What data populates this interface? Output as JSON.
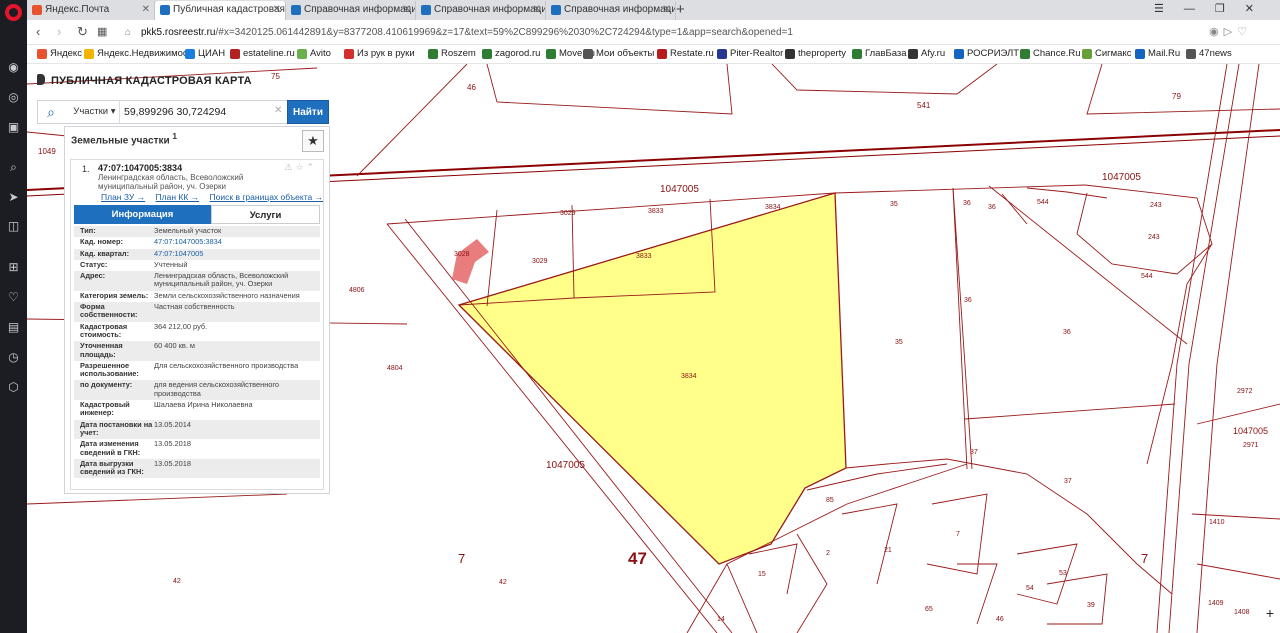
{
  "browser": {
    "tabs": [
      {
        "label": "Яндекс.Почта",
        "fav_color": "#e8532f"
      },
      {
        "label": "Публичная кадастровая к",
        "fav_color": "#1f6fbf"
      },
      {
        "label": "Справочная информация",
        "fav_color": "#1f6fbf"
      },
      {
        "label": "Справочная информация",
        "fav_color": "#1f6fbf"
      },
      {
        "label": "Справочная информация",
        "fav_color": "#1f6fbf"
      }
    ],
    "url_host": "pkk5.rosreestr.ru",
    "url_rest": "/#x=3420125.061442891&y=8377208.410619969&z=17&text=59%2C899296%2030%2C724294&type=1&app=search&opened=1",
    "bookmarks": [
      {
        "label": "Яндекс",
        "color": "#e8532f"
      },
      {
        "label": "Яндекс.Недвижимос",
        "color": "#f3b400"
      },
      {
        "label": "ЦИАН",
        "color": "#1a7ee0"
      },
      {
        "label": "estateline.ru",
        "color": "#b22222"
      },
      {
        "label": "Avito",
        "color": "#6ab04c"
      },
      {
        "label": "Из рук в руки",
        "color": "#d32f2f"
      },
      {
        "label": "Roszem",
        "color": "#2e7d32"
      },
      {
        "label": "zagorod.ru",
        "color": "#2e7d32"
      },
      {
        "label": "Move.su",
        "color": "#2e7d32"
      },
      {
        "label": "Мои объекты",
        "color": "#555555"
      },
      {
        "label": "Restate.ru",
        "color": "#b71c1c"
      },
      {
        "label": "Piter-Realtor",
        "color": "#283593"
      },
      {
        "label": "theproperty",
        "color": "#333333"
      },
      {
        "label": "ГлавБаза",
        "color": "#2e7d32"
      },
      {
        "label": "Afy.ru",
        "color": "#333333"
      },
      {
        "label": "РОСРИЭЛТ",
        "color": "#1565c0"
      },
      {
        "label": "Chance.Ru",
        "color": "#2e7d32"
      },
      {
        "label": "Сигмакс",
        "color": "#689f38"
      },
      {
        "label": "Mail.Ru",
        "color": "#1565c0"
      },
      {
        "label": "47news",
        "color": "#555555"
      }
    ]
  },
  "app": {
    "title": "ПУБЛИЧНАЯ КАДАСТРОВАЯ КАРТА",
    "search": {
      "type_label": "Участки",
      "value": "59,899296 30,724294",
      "button": "Найти"
    },
    "panel": {
      "heading": "Земельные участки",
      "heading_sup": "1",
      "result_num": "1.",
      "cad_number": "47:07:1047005:3834",
      "address_short": "Ленинградская область, Всеволожский муниципальный район, уч. Озерки",
      "links": [
        "План ЗУ →",
        "План КК →",
        "Поиск в границах объекта →"
      ],
      "tab_info": "Информация",
      "tab_services": "Услуги",
      "props": [
        {
          "k": "Тип:",
          "v": "Земельный участок"
        },
        {
          "k": "Кад. номер:",
          "v": "47:07:1047005:3834",
          "link": true
        },
        {
          "k": "Кад. квартал:",
          "v": "47:07:1047005",
          "link": true
        },
        {
          "k": "Статус:",
          "v": "Учтенный"
        },
        {
          "k": "Адрес:",
          "v": "Ленинградская область, Всеволожский муниципальный район, уч. Озерки"
        },
        {
          "k": "Категория земель:",
          "v": "Земли сельскохозяйственного назначения"
        },
        {
          "k": "Форма собственности:",
          "v": "Частная собственность"
        },
        {
          "k": "Кадастровая стоимость:",
          "v": "364 212,00 руб."
        },
        {
          "k": "Уточненная площадь:",
          "v": "60 400 кв. м"
        },
        {
          "k": "Разрешенное использование:",
          "v": "Для сельскохозяйственного производства"
        },
        {
          "k": "по документу:",
          "v": "для ведения сельскохозяйственного производства"
        },
        {
          "k": "Кадастровый инженер:",
          "v": "Шалаева Ирина Николаевна"
        },
        {
          "k": "Дата постановки на учет:",
          "v": "13.05.2014"
        },
        {
          "k": "Дата изменения сведений в ГКН:",
          "v": "13.05.2018"
        },
        {
          "k": "Дата выгрузки сведений из ГКН:",
          "v": "13.05.2018"
        }
      ]
    }
  },
  "map_labels": [
    "75",
    "46",
    "541",
    "79",
    "1049",
    "1047005",
    "1047005",
    "3029",
    "3833",
    "3834",
    "35",
    "36",
    "36",
    "544",
    "243",
    "243",
    "3028",
    "3029",
    "3833",
    "544",
    "4806",
    "36",
    "36",
    "35",
    "3834",
    "4804",
    "2972",
    "1047005",
    "2971",
    "37",
    "1047005",
    "37",
    "85",
    "7",
    "1410",
    "7",
    "47",
    "7",
    "2",
    "21",
    "15",
    "53",
    "54",
    "39",
    "42",
    "42",
    "1409",
    "1408",
    "65",
    "46",
    "14"
  ]
}
